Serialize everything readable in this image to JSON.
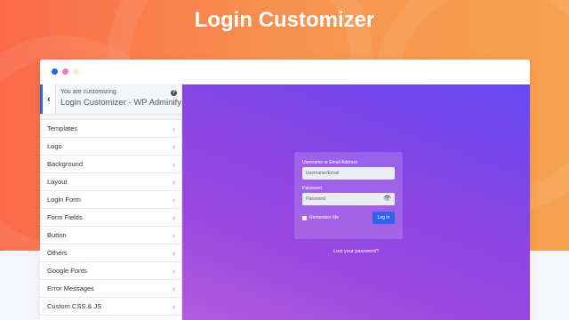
{
  "hero": {
    "title": "Login Customizer"
  },
  "window": {
    "dots": [
      "#2463eb",
      "#f178b6",
      "#fde7d4"
    ]
  },
  "sidebar": {
    "header_small": "You are customizing",
    "header_title": "Login Customizer - WP Adminify",
    "help_glyph": "?",
    "items": [
      {
        "label": "Templates"
      },
      {
        "label": "Logo"
      },
      {
        "label": "Background"
      },
      {
        "label": "Layout"
      },
      {
        "label": "Login Form"
      },
      {
        "label": "Form Fields"
      },
      {
        "label": "Button"
      },
      {
        "label": "Others"
      },
      {
        "label": "Google Fonts"
      },
      {
        "label": "Error Messages"
      },
      {
        "label": "Custom CSS & JS"
      }
    ]
  },
  "login_form": {
    "username_label": "Username or Email Address",
    "username_placeholder": "Username/Email",
    "password_label": "Password",
    "password_placeholder": "Password",
    "remember_label": "Remember Me",
    "login_button": "Log In",
    "lost_password": "Lost your password?"
  },
  "colors": {
    "hero_gradient_start": "#fb6a4a",
    "hero_gradient_end": "#f6a24f",
    "accent_blue": "#2e63ef",
    "preview_purple": "#8b45e3"
  }
}
